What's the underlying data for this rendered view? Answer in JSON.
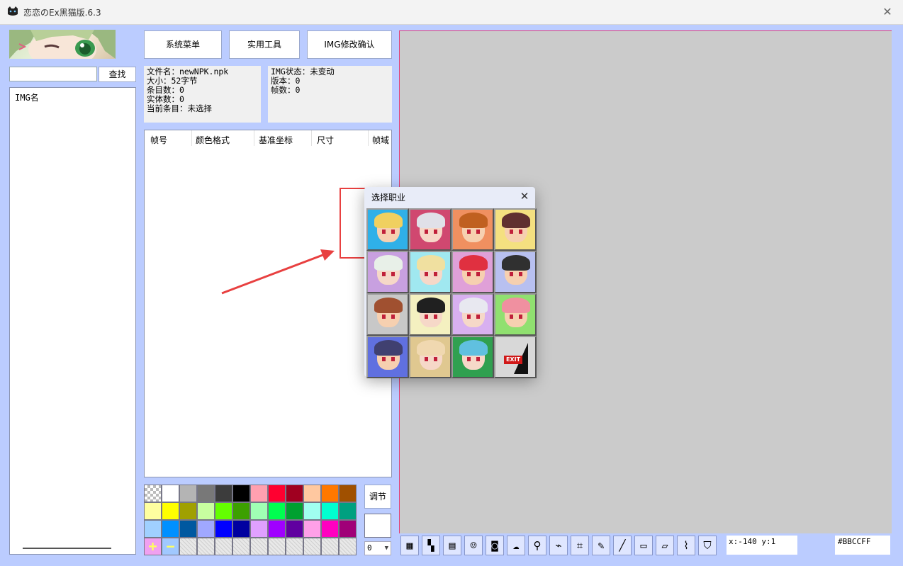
{
  "window": {
    "title": "恋恋のEx黑猫版.6.3"
  },
  "search": {
    "value": "",
    "button": "查找"
  },
  "img_list": {
    "header": "IMG名"
  },
  "top_buttons": {
    "system_menu": "系统菜单",
    "tools": "实用工具",
    "img_confirm": "IMG修改确认"
  },
  "file_info": {
    "lines": [
      "文件名：newNPK.npk",
      "大小：52字节",
      "条目数：0",
      "实体数：0",
      "当前条目：未选择"
    ]
  },
  "img_info": {
    "lines": [
      "IMG状态：未变动",
      "版本：0",
      "帧数：0"
    ]
  },
  "frame_table": {
    "columns": [
      "帧号",
      "颜色格式",
      "基准坐标",
      "尺寸",
      "帧域"
    ]
  },
  "palette": {
    "colors": [
      "checker",
      "#ffffff",
      "#b4b4b4",
      "#787878",
      "#3c3c3c",
      "#000000",
      "#ffa0b0",
      "#ff0030",
      "#a00020",
      "#ffc8a0",
      "#ff7800",
      "#a05000",
      "#ffffa0",
      "#ffff00",
      "#a0a000",
      "#c8ffa0",
      "#64ff00",
      "#3ca000",
      "#a0ffb4",
      "#00ff50",
      "#00a030",
      "#a0fff0",
      "#00ffd0",
      "#00a080",
      "#a0d0ff",
      "#0090ff",
      "#0058a0",
      "#a0a8ff",
      "#0000ff",
      "#0000a0",
      "#e0a0ff",
      "#a000ff",
      "#6000a0",
      "#ffa0e8",
      "#ff00c0",
      "#a00078",
      "plus",
      "minus",
      "hatch",
      "hatch",
      "hatch",
      "hatch",
      "hatch",
      "hatch",
      "hatch",
      "hatch",
      "hatch",
      "hatch"
    ],
    "add_label": "+",
    "remove_label": "−"
  },
  "side_controls": {
    "adjust": "调节",
    "size_value": "0"
  },
  "toolbar": {
    "tools": [
      "grid-icon",
      "color-blocks-icon",
      "film-icon",
      "cat-icon",
      "camera-icon",
      "cloud-icon",
      "magnifier-icon",
      "chart-icon",
      "crop-icon",
      "pencil-icon",
      "line-icon",
      "rectangle-icon",
      "eraser-icon",
      "eyedropper-icon",
      "bucket-icon"
    ],
    "glyphs": [
      "▦",
      "▚",
      "▤",
      "☺",
      "◙",
      "☁",
      "⚲",
      "⌁",
      "⌗",
      "✎",
      "╱",
      "▭",
      "▱",
      "⌇",
      "⛉"
    ]
  },
  "status": {
    "coords": "x:-140 y:1",
    "color_code": "#BBCCFF"
  },
  "dialog": {
    "title": "选择职业",
    "jobs": [
      {
        "bg": "#2fb0e8",
        "hair": "#f0d060",
        "skin": "#f6d0b0"
      },
      {
        "bg": "#d04870",
        "hair": "#e0e0e8",
        "skin": "#f6d8c8"
      },
      {
        "bg": "#f09060",
        "hair": "#c06020",
        "skin": "#f6d0b0"
      },
      {
        "bg": "#f4e080",
        "hair": "#603030",
        "skin": "#f6d0b0"
      },
      {
        "bg": "#c8a0e0",
        "hair": "#e8f0e8",
        "skin": "#f6d8c8"
      },
      {
        "bg": "#a0e8f0",
        "hair": "#f0e0a0",
        "skin": "#f6d8c8"
      },
      {
        "bg": "#e0a0d8",
        "hair": "#e03040",
        "skin": "#f6d0b0"
      },
      {
        "bg": "#b8c0f0",
        "hair": "#303030",
        "skin": "#f6d0b0"
      },
      {
        "bg": "#c8c8c8",
        "hair": "#a05030",
        "skin": "#f6d0b0"
      },
      {
        "bg": "#f4f0c0",
        "hair": "#202020",
        "skin": "#f6d8c8"
      },
      {
        "bg": "#d8b0f0",
        "hair": "#e8e8f0",
        "skin": "#f6d8c8"
      },
      {
        "bg": "#90e070",
        "hair": "#f090a0",
        "skin": "#f6d0b0"
      },
      {
        "bg": "#6070e0",
        "hair": "#404070",
        "skin": "#f6d0b0"
      },
      {
        "bg": "#e0c890",
        "hair": "#f0d8b0",
        "skin": "#f6d8c8"
      },
      {
        "bg": "#30a050",
        "hair": "#60c0e0",
        "skin": "#f6d8c8"
      },
      {
        "bg": "#d8d8d8",
        "exit": true,
        "label": "EXIT"
      }
    ]
  }
}
